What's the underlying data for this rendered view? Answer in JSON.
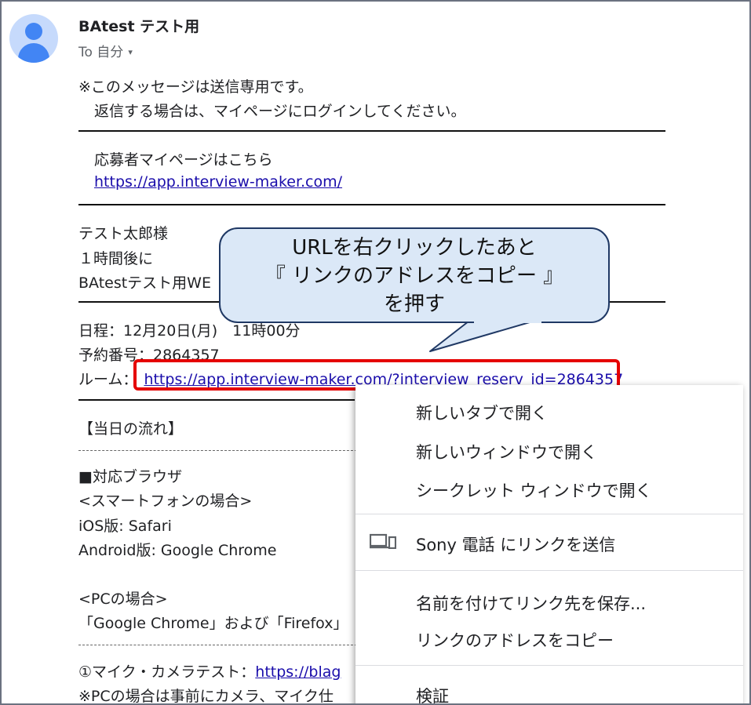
{
  "header": {
    "sender": "BAtest テスト用",
    "recipient": "To 自分",
    "recipient_caret": "▾"
  },
  "body": {
    "notice_line1": "※このメッセージは送信専用です。",
    "notice_line2": "返信する場合は、マイページにログインしてください。",
    "mypage_label": "応募者マイページはこちら",
    "mypage_url": "https://app.interview-maker.com/",
    "greeting": "テスト太郎様",
    "time_notice": "１時間後に",
    "company_partial": "BAtestテスト用WE",
    "schedule": "日程：12月20日(月)　11時00分",
    "reservation": "予約番号：2864357",
    "room_label": "ルーム：",
    "room_url": "https://app.interview-maker.com/?interview_reserv_id=2864357",
    "flow_heading": "【当日の流れ】",
    "browser_heading": "■対応ブラウザ",
    "smartphone_heading": "<スマートフォンの場合>",
    "ios": "iOS版: Safari",
    "android": "Android版: Google Chrome",
    "pc_heading": "<PCの場合>",
    "pc_browsers": "「Google Chrome」および「Firefox」",
    "mic_test_label": "①マイク・カメラテスト：",
    "mic_test_url": "https://blag",
    "pc_note": "※PCの場合は事前にカメラ、マイク仕"
  },
  "callout": {
    "line1": "URLを右クリックしたあと",
    "line2": "『 リンクのアドレスをコピー 』",
    "line3": "を押す"
  },
  "context_menu": {
    "items": [
      "新しいタブで開く",
      "新しいウィンドウで開く",
      "シークレット ウィンドウで開く",
      "Sony 電話 にリンクを送信",
      "名前を付けてリンク先を保存...",
      "リンクのアドレスをコピー",
      "検証"
    ]
  },
  "colors": {
    "link": "#1a0dab",
    "highlight": "#e50000",
    "callout_fill": "#dbe8f7",
    "callout_border": "#1f3864"
  }
}
